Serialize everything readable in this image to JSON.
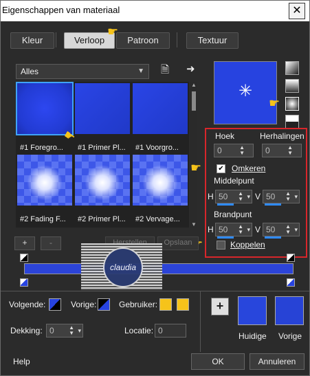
{
  "window": {
    "title": "Eigenschappen van materiaal",
    "close": "✕"
  },
  "tabs": [
    {
      "label": "Kleur"
    },
    {
      "label": "Verloop"
    },
    {
      "label": "Patroon"
    },
    {
      "label": "Textuur"
    }
  ],
  "gallery": {
    "filter": "Alles",
    "items": [
      {
        "caption": "#1 Foregro..."
      },
      {
        "caption": "#1 Primer Pl..."
      },
      {
        "caption": "#1 Voorgro..."
      },
      {
        "caption": "#2 Fading F..."
      },
      {
        "caption": "#2 Primer Pl..."
      },
      {
        "caption": "#2 Vervage..."
      }
    ]
  },
  "settings": {
    "hoek_label": "Hoek",
    "hoek_value": "0",
    "herhalingen_label": "Herhalingen",
    "herhalingen_value": "0",
    "omkeren_label": "Omkeren",
    "omkeren_checked": true,
    "middelpunt_label": "Middelpunt",
    "middelpunt_h_label": "H",
    "middelpunt_h": "50",
    "middelpunt_v_label": "V",
    "middelpunt_v": "50",
    "brandpunt_label": "Brandpunt",
    "brandpunt_h_label": "H",
    "brandpunt_h": "50",
    "brandpunt_v_label": "V",
    "brandpunt_v": "50",
    "koppelen_label": "Koppelen",
    "koppelen_checked": false
  },
  "actions": {
    "add": "+",
    "remove": "-",
    "herstellen": "Herstellen",
    "opslaan": "Opslaan"
  },
  "bottom": {
    "volgende_label": "Volgende:",
    "vorige_label": "Vorige:",
    "gebruiker_label": "Gebruiker:",
    "dekking_label": "Dekking:",
    "dekking_value": "0",
    "locatie_label": "Locatie:",
    "locatie_value": "0",
    "add_button": "+",
    "huidige_label": "Huidige",
    "vorige_swatch_label": "Vorige"
  },
  "footer": {
    "help": "Help",
    "ok": "OK",
    "annuleren": "Annuleren"
  },
  "watermark": {
    "text": "claudia"
  },
  "colors": {
    "accent_blue": "#2743e0",
    "highlight_red": "#d8262b",
    "gold": "#f6c31a"
  }
}
